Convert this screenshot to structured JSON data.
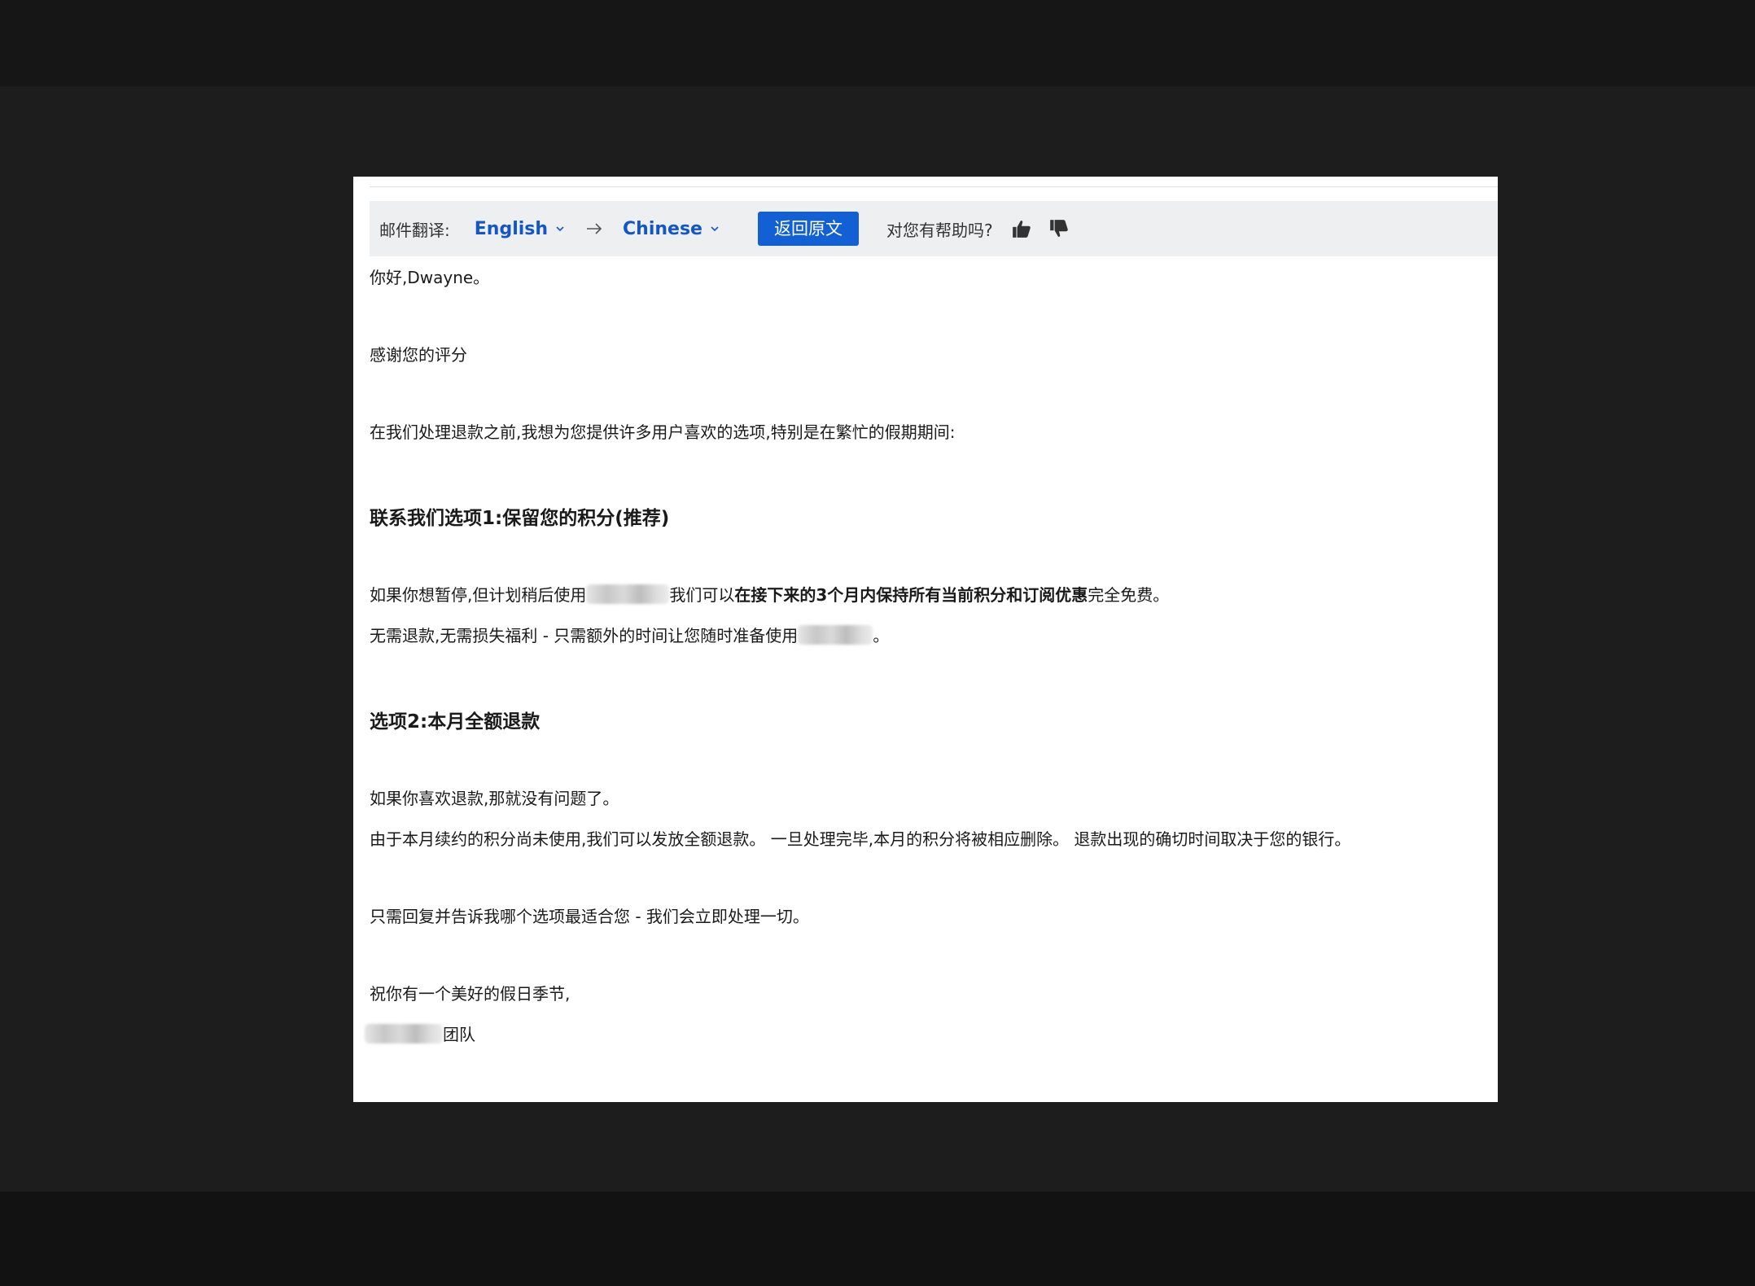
{
  "toolbar": {
    "label": "邮件翻译:",
    "source_language": "English",
    "target_language": "Chinese",
    "restore_button": "返回原文",
    "helpful_prompt": "对您有帮助吗?"
  },
  "email": {
    "greeting": "你好,Dwayne。",
    "thanks": "感谢您的评分",
    "intro": "在我们处理退款之前,我想为您提供许多用户喜欢的选项,特别是在繁忙的假期期间:",
    "option1_heading": "联系我们选项1:保留您的积分(推荐)",
    "option1_line1_prefix": "如果你想暂停,但计划稍后使用",
    "option1_line1_mid": "我们可以",
    "option1_line1_bold": "在接下来的3个月内保持所有当前积分和订阅优惠",
    "option1_line1_suffix": "完全免费。",
    "option1_line2_prefix": "无需退款,无需损失福利 - 只需额外的时间让您随时准备使用",
    "option1_line2_suffix": "。",
    "option2_heading": "选项2:本月全额退款",
    "option2_line1": "如果你喜欢退款,那就没有问题了。",
    "option2_line2": "由于本月续约的积分尚未使用,我们可以发放全额退款。 一旦处理完毕,本月的积分将被相应删除。 退款出现的确切时间取决于您的银行。",
    "reply_prompt": "只需回复并告诉我哪个选项最适合您 - 我们会立即处理一切。",
    "closing": "祝你有一个美好的假日季节,",
    "signature_suffix": "团队"
  }
}
